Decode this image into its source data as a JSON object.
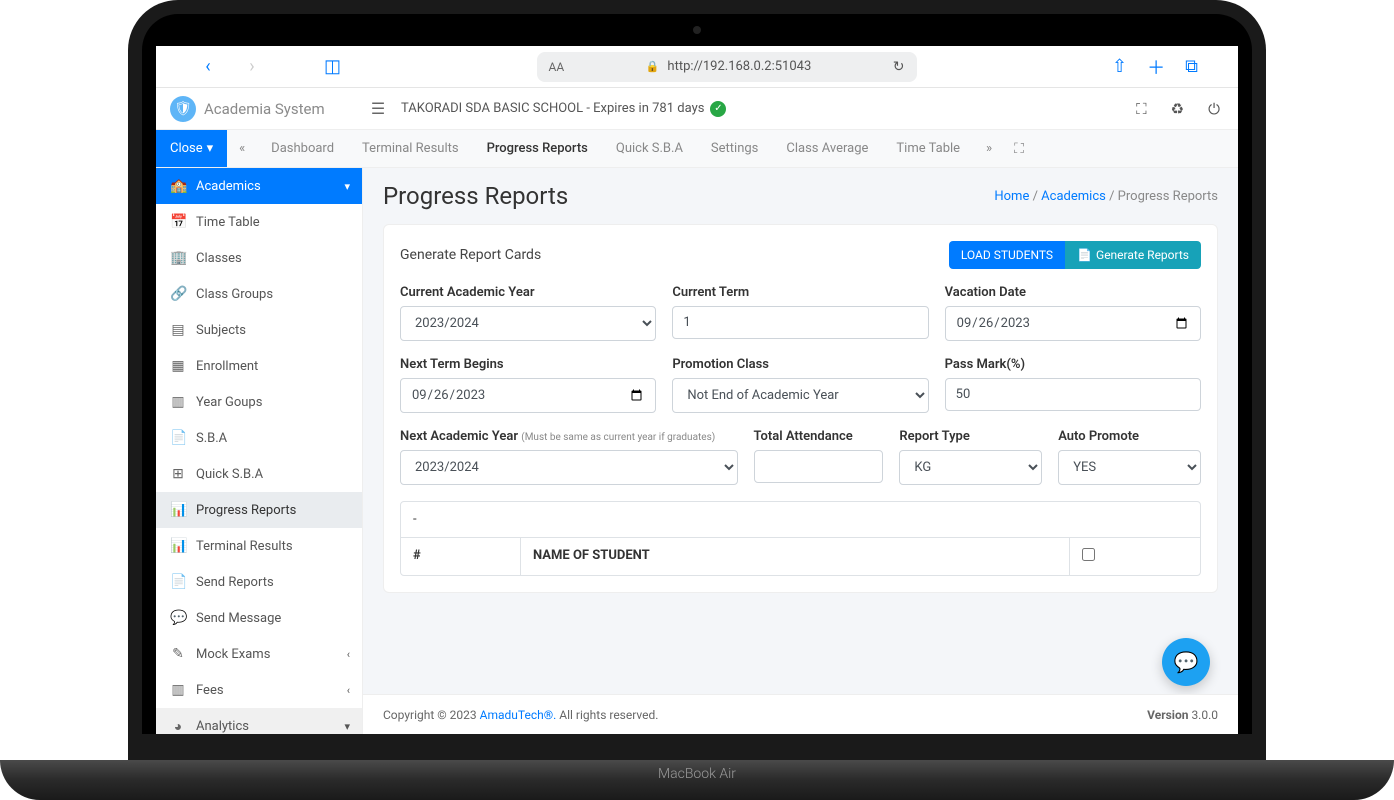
{
  "device_brand": "MacBook Air",
  "browser": {
    "url": "http://192.168.0.2:51043",
    "text_size": "AA"
  },
  "brand": "Academia System",
  "school_status": "TAKORADI SDA BASIC SCHOOL - Expires in 781 days",
  "close_label": "Close",
  "tabs": [
    "Dashboard",
    "Terminal Results",
    "Progress Reports",
    "Quick S.B.A",
    "Settings",
    "Class Average",
    "Time Table"
  ],
  "active_tab": "Progress Reports",
  "sidebar": {
    "section": "Academics",
    "items": [
      "Time Table",
      "Classes",
      "Class Groups",
      "Subjects",
      "Enrollment",
      "Year Goups",
      "S.B.A",
      "Quick S.B.A",
      "Progress Reports",
      "Terminal Results",
      "Send Reports",
      "Send Message",
      "Mock Exams",
      "Fees"
    ],
    "active": "Progress Reports",
    "analytics": "Analytics"
  },
  "page": {
    "title": "Progress Reports",
    "breadcrumb": {
      "home": "Home",
      "mid": "Academics",
      "current": "Progress Reports"
    }
  },
  "card": {
    "title": "Generate Report Cards",
    "load_btn": "LOAD STUDENTS",
    "gen_btn": "Generate Reports"
  },
  "form": {
    "current_year": {
      "label": "Current Academic Year",
      "value": "2023/2024"
    },
    "current_term": {
      "label": "Current Term",
      "value": "1"
    },
    "vacation_date": {
      "label": "Vacation Date",
      "value": "09/26/2023"
    },
    "next_term": {
      "label": "Next Term Begins",
      "value": "09/26/2023"
    },
    "promotion": {
      "label": "Promotion Class",
      "value": "Not End of Academic Year"
    },
    "pass_mark": {
      "label": "Pass Mark(%)",
      "value": "50"
    },
    "next_year": {
      "label": "Next Academic Year",
      "hint": "(Must be same as current year if graduates)",
      "value": "2023/2024"
    },
    "attendance": {
      "label": "Total Attendance",
      "value": ""
    },
    "report_type": {
      "label": "Report Type",
      "value": "KG"
    },
    "auto_promote": {
      "label": "Auto Promote",
      "value": "YES"
    }
  },
  "table": {
    "dash": "-",
    "col_num": "#",
    "col_name": "NAME OF STUDENT"
  },
  "footer": {
    "copyright": "Copyright © 2023 ",
    "brand": "AmaduTech®.",
    "rights": " All rights reserved.",
    "version_label": "Version ",
    "version": "3.0.0"
  }
}
